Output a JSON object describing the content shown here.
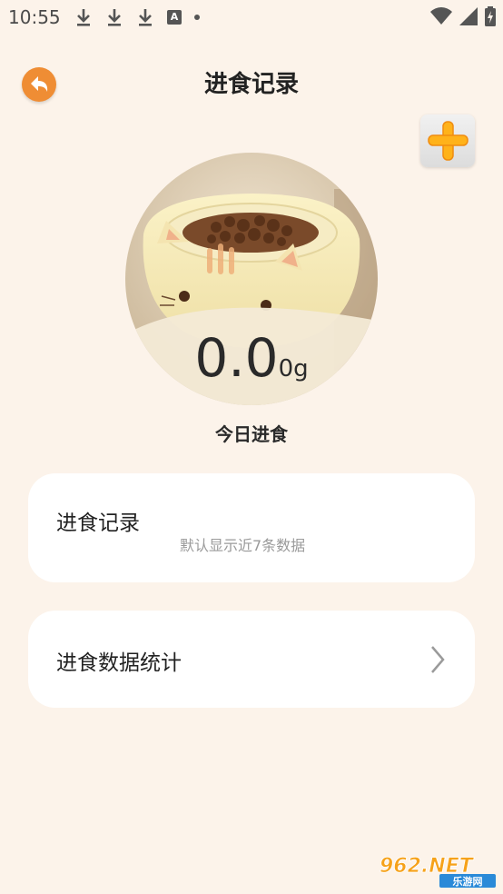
{
  "status_bar": {
    "time": "10:55",
    "a_icon": "A"
  },
  "header": {
    "title": "进食记录"
  },
  "summary": {
    "value": "0.0",
    "unit": "0g",
    "label": "今日进食"
  },
  "cards": {
    "records": {
      "title": "进食记录",
      "subtitle": "默认显示近7条数据"
    },
    "stats": {
      "title": "进食数据统计"
    }
  },
  "watermark": {
    "brand": "962.NET",
    "sub": "乐游网"
  },
  "colors": {
    "background": "#fcf3ea",
    "accent": "#ef8d34",
    "plus": "#ffb21a"
  }
}
